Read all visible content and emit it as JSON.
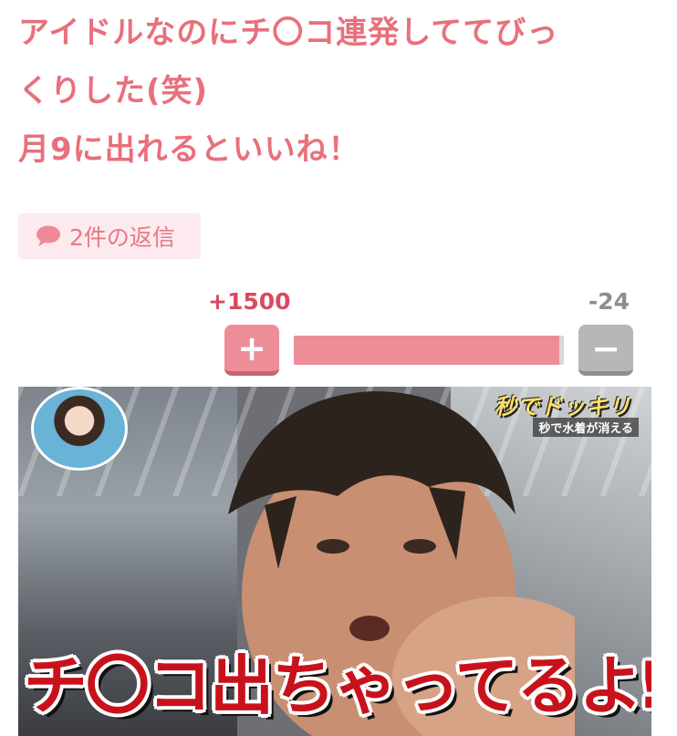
{
  "comment": {
    "lines": [
      "アイドルなのにチ〇コ連発しててびっ",
      "くりした(笑)",
      "月9に出れるといいね！"
    ]
  },
  "replies": {
    "label": "2件の返信",
    "icon": "speech-bubble-icon"
  },
  "votes": {
    "plus_count": "+1500",
    "minus_count": "-24",
    "plus_glyph": "+",
    "minus_glyph": "−",
    "plus_ratio": 0.984,
    "plus_color": "#ec8d98",
    "minus_color": "#b7b7b7"
  },
  "photo": {
    "logo": "秒でドッキリ",
    "logo_sub": "秒で水着が消える",
    "caption": "チ〇コ出ちゃってるよ⁉"
  },
  "colors": {
    "accent": "#e8707c",
    "badge_bg": "#fdeaee"
  }
}
